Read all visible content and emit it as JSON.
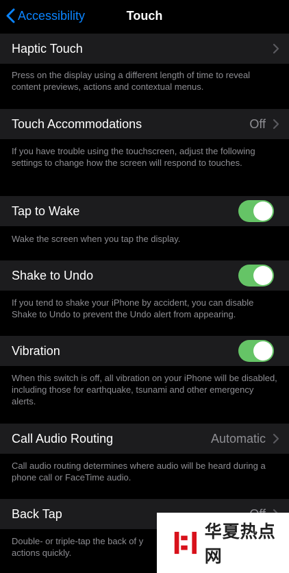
{
  "nav": {
    "back_label": "Accessibility",
    "title": "Touch"
  },
  "rows": [
    {
      "label": "Haptic Touch",
      "value": "",
      "control": "chevron",
      "description": "Press on the display using a different length of time to reveal content previews, actions and contextual menus."
    },
    {
      "label": "Touch Accommodations",
      "value": "Off",
      "control": "chevron",
      "description": "If you have trouble using the touchscreen, adjust the following settings to change how the screen will respond to touches."
    },
    {
      "label": "Tap to Wake",
      "value": "",
      "control": "toggle",
      "on": true,
      "description": "Wake the screen when you tap the display."
    },
    {
      "label": "Shake to Undo",
      "value": "",
      "control": "toggle",
      "on": true,
      "description": "If you tend to shake your iPhone by accident, you can disable Shake to Undo to prevent the Undo alert from appearing."
    },
    {
      "label": "Vibration",
      "value": "",
      "control": "toggle",
      "on": true,
      "description": "When this switch is off, all vibration on your iPhone will be disabled, including those for earthquake, tsunami and other emergency alerts."
    },
    {
      "label": "Call Audio Routing",
      "value": "Automatic",
      "control": "chevron",
      "description": "Call audio routing determines where audio will be heard during a phone call or FaceTime audio."
    },
    {
      "label": "Back Tap",
      "value": "Off",
      "control": "chevron",
      "description": "Double- or triple-tap the back of y actions quickly."
    }
  ],
  "watermark": {
    "text": "华夏热点网"
  },
  "colors": {
    "accent": "#0a84ff",
    "toggle_on": "#65c466",
    "cell_bg": "#1c1c1e",
    "secondary_text": "#8e8e93"
  }
}
